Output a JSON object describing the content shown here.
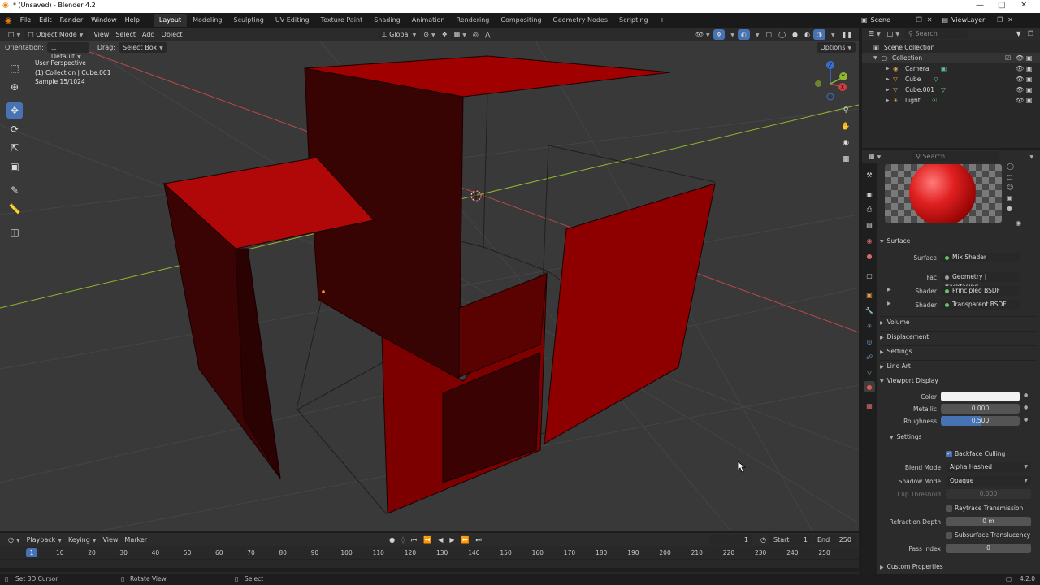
{
  "window": {
    "title": "* (Unsaved) - Blender 4.2"
  },
  "menu": [
    "File",
    "Edit",
    "Render",
    "Window",
    "Help"
  ],
  "workspaces": [
    "Layout",
    "Modeling",
    "Sculpting",
    "UV Editing",
    "Texture Paint",
    "Shading",
    "Animation",
    "Rendering",
    "Compositing",
    "Geometry Nodes",
    "Scripting"
  ],
  "workspace_add": "+",
  "scene": {
    "name": "Scene",
    "view_layer": "ViewLayer"
  },
  "viewport_header": {
    "mode": "Object Mode",
    "items": [
      "View",
      "Select",
      "Add",
      "Object"
    ],
    "transform": "Global",
    "orientation_label": "Orientation:",
    "orientation": "Default",
    "drag_label": "Drag:",
    "drag": "Select Box",
    "options": "Options"
  },
  "viewport_info": {
    "line1": "User Perspective",
    "line2": "(1) Collection | Cube.001",
    "line3": "Sample 15/1024"
  },
  "gizmo": {
    "x": "X",
    "y": "Y",
    "z": "Z"
  },
  "outliner": {
    "search_placeholder": "Search",
    "scene_collection": "Scene Collection",
    "collection": "Collection",
    "items": [
      {
        "name": "Camera",
        "icon": "camera-icon"
      },
      {
        "name": "Cube",
        "icon": "mesh-icon"
      },
      {
        "name": "Cube.001",
        "icon": "mesh-icon"
      },
      {
        "name": "Light",
        "icon": "light-icon"
      }
    ]
  },
  "properties": {
    "search_placeholder": "Search",
    "surface_panel": "Surface",
    "surface_label": "Surface",
    "surface_value": "Mix Shader",
    "fac_label": "Fac",
    "fac_value": "Geometry | Backfacing",
    "shader1_label": "Shader",
    "shader1_value": "Principled BSDF",
    "shader2_label": "Shader",
    "shader2_value": "Transparent BSDF",
    "volume": "Volume",
    "displacement": "Displacement",
    "settings": "Settings",
    "line_art": "Line Art",
    "viewport_display": "Viewport Display",
    "color_label": "Color",
    "metallic_label": "Metallic",
    "metallic_value": "0.000",
    "roughness_label": "Roughness",
    "roughness_value": "0.500",
    "roughness_fraction": 0.5,
    "vd_settings": "Settings",
    "backface_culling": "Backface Culling",
    "blend_mode_label": "Blend Mode",
    "blend_mode_value": "Alpha Hashed",
    "shadow_mode_label": "Shadow Mode",
    "shadow_mode_value": "Opaque",
    "clip_threshold_label": "Clip Threshold",
    "clip_threshold_value": "0.000",
    "raytrace_transmission": "Raytrace Transmission",
    "refraction_depth_label": "Refraction Depth",
    "refraction_depth_value": "0 m",
    "subsurface_translucency": "Subsurface Translucency",
    "pass_index_label": "Pass Index",
    "pass_index_value": "0",
    "custom_properties": "Custom Properties"
  },
  "timeline": {
    "menus": [
      "Playback",
      "Keying",
      "View",
      "Marker"
    ],
    "current_frame": "1",
    "start_label": "Start",
    "start_value": "1",
    "end_label": "End",
    "end_value": "250",
    "ticks": [
      "10",
      "20",
      "30",
      "40",
      "50",
      "60",
      "70",
      "80",
      "90",
      "100",
      "110",
      "120",
      "130",
      "140",
      "150",
      "160",
      "170",
      "180",
      "190",
      "200",
      "210",
      "220",
      "230",
      "240",
      "250"
    ],
    "playhead": "1"
  },
  "statusbar": {
    "set_cursor": "Set 3D Cursor",
    "rotate_view": "Rotate View",
    "select": "Select",
    "version": "4.2.0"
  },
  "colors": {
    "accent": "#4772b3",
    "object_red": "#a00000",
    "viewport_bg": "#393939",
    "x_axis": "#d04040",
    "y_axis": "#8fb82e"
  }
}
